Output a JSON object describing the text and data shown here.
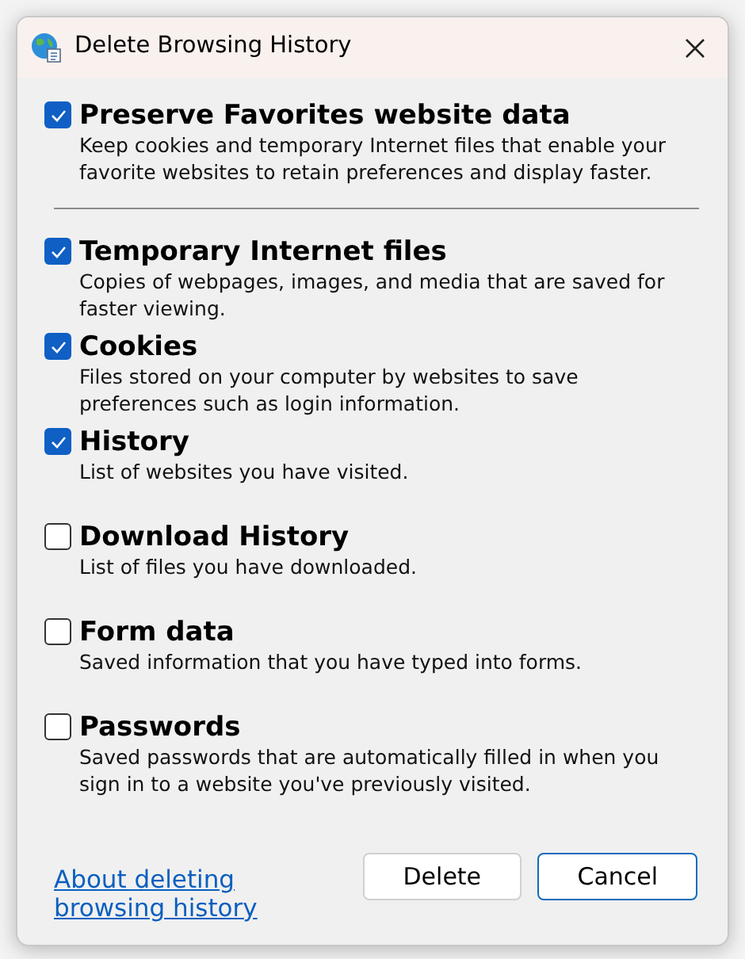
{
  "dialog": {
    "title": "Delete Browsing History"
  },
  "preserve": {
    "label": "Preserve Favorites website data",
    "description": "Keep cookies and temporary Internet files that enable your favorite websites to retain preferences and display faster.",
    "checked": true
  },
  "options": [
    {
      "label": "Temporary Internet files",
      "description": "Copies of webpages, images, and media that are saved for faster viewing.",
      "checked": true
    },
    {
      "label": "Cookies",
      "description": "Files stored on your computer by websites to save preferences such as login information.",
      "checked": true
    },
    {
      "label": "History",
      "description": "List of websites you have visited.",
      "checked": true
    },
    {
      "label": "Download History",
      "description": "List of files you have downloaded.",
      "checked": false
    },
    {
      "label": "Form data",
      "description": "Saved information that you have typed into forms.",
      "checked": false
    },
    {
      "label": "Passwords",
      "description": "Saved passwords that are automatically filled in when you sign in to a website you've previously visited.",
      "checked": false
    }
  ],
  "link": "About deleting browsing history",
  "buttons": [
    {
      "label": "Delete",
      "kind": "normal"
    },
    {
      "label": "Cancel",
      "kind": "default"
    }
  ]
}
